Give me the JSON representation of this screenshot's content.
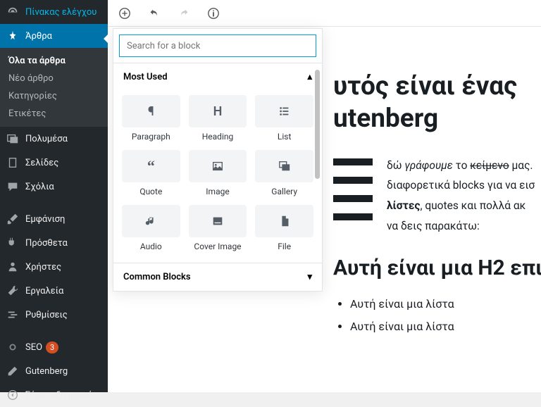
{
  "sidebar": {
    "dashboard": "Πίνακας ελέγχου",
    "posts": "Άρθρα",
    "posts_sub": {
      "all": "Όλα τα άρθρα",
      "new": "Νέο άρθρο",
      "cats": "Κατηγορίες",
      "tags": "Ετικέτες"
    },
    "media": "Πολυμέσα",
    "pages": "Σελίδες",
    "comments": "Σχόλια",
    "appearance": "Εμφάνιση",
    "plugins": "Πρόσθετα",
    "users": "Χρήστες",
    "tools": "Εργαλεία",
    "settings": "Ρυθμίσεις",
    "seo": "SEO",
    "seo_badge": "3",
    "gutenberg": "Gutenberg",
    "collapse": "Σύμπτυξη μενού"
  },
  "inserter": {
    "search_placeholder": "Search for a block",
    "most_used": "Most Used",
    "common_blocks": "Common Blocks",
    "blocks": {
      "paragraph": "Paragraph",
      "heading": "Heading",
      "list": "List",
      "quote": "Quote",
      "image": "Image",
      "gallery": "Gallery",
      "audio": "Audio",
      "cover": "Cover Image",
      "file": "File"
    }
  },
  "content": {
    "h1_a": "υτός είναι ένας",
    "h1_b": "utenberg",
    "para": [
      "δώ <em>γράφουμε</em> το <span class='strike'>κείμενο</span> μας.",
      "διαφορετικά blocks για να εισ",
      "<strong>λίστες</strong>, quotes και πολλά ακ",
      "να δεις παρακάτω:"
    ],
    "h2": "Αυτή είναι μια H2 επι",
    "li1": "Αυτή είναι μια λίστα",
    "li2": "Αυτή είναι μια λίστα"
  }
}
